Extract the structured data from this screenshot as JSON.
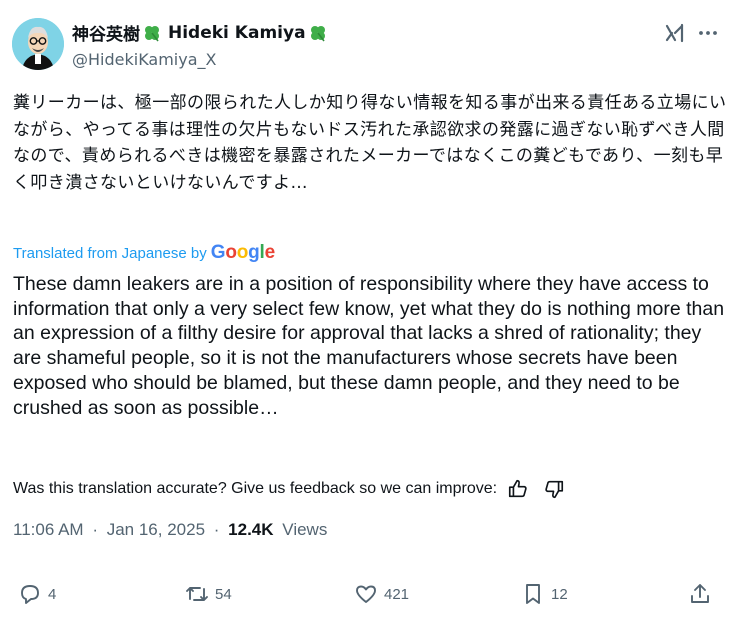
{
  "author": {
    "display_name_jp": "神谷英樹",
    "display_name_en": "Hideki Kamiya",
    "handle": "@HidekiKamiya_X",
    "avatar_icon": "cartoon-avatar-icon",
    "badge_icon": "clover-icon"
  },
  "post": {
    "original_text": "糞リーカーは、極一部の限られた人しか知り得ない情報を知る事が出来る責任ある立場にいながら、やってる事は理性の欠片もないドス汚れた承認欲求の発露に過ぎない恥ずべき人間なので、責められるべきは機密を暴露されたメーカーではなくこの糞どもであり、一刻も早く叩き潰さないといけないんですよ…",
    "translated_label": "Translated from Japanese by",
    "translator": "Google",
    "translated_text": "These damn leakers are in a position of responsibility where they have access to information that only a very select few know, yet what they do is nothing more than an expression of a filthy desire for approval that lacks a shred of rationality; they are shameful people, so it is not the manufacturers whose secrets have been exposed who should be blamed, but these damn people, and they need to be crushed as soon as possible…",
    "feedback_prompt": "Was this translation accurate? Give us feedback so we can improve:"
  },
  "meta": {
    "time": "11:06 AM",
    "date": "Jan 16, 2025",
    "views_count": "12.4K",
    "views_label": "Views",
    "separator": "·"
  },
  "actions": {
    "replies": "4",
    "reposts": "54",
    "likes": "421",
    "bookmarks": "12"
  },
  "colors": {
    "text": "#0f1419",
    "secondary": "#536471",
    "link": "#1d9bf0",
    "clover": "#3fae49"
  }
}
